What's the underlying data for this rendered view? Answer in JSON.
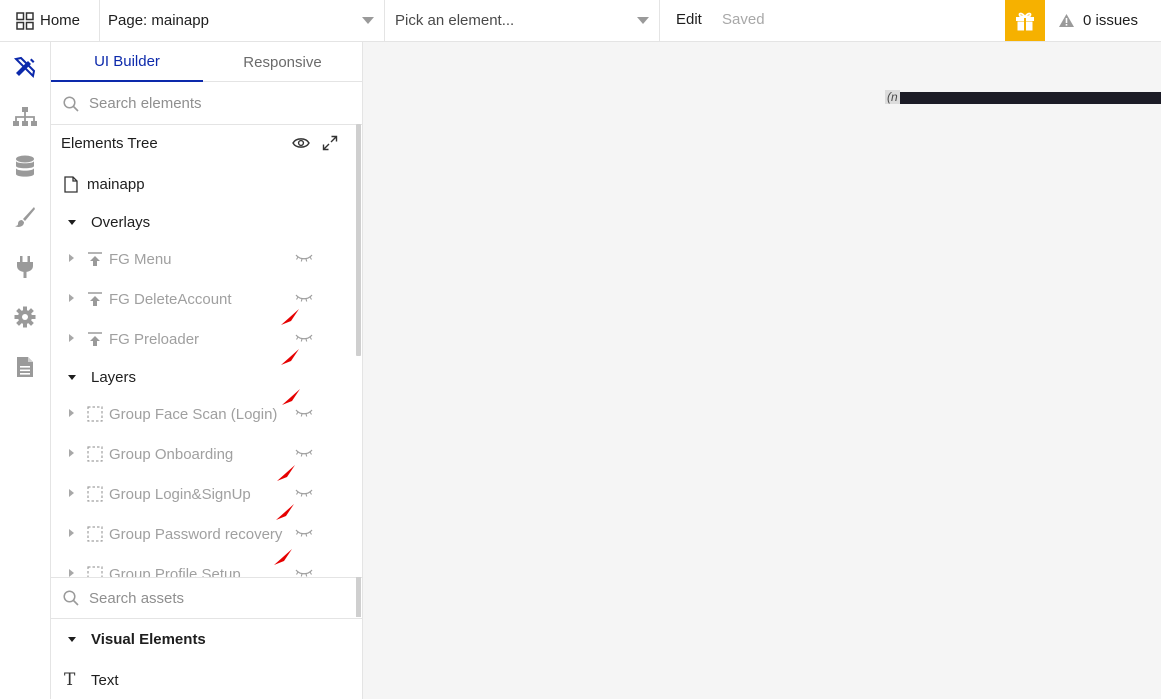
{
  "topbar": {
    "home_label": "Home",
    "page_selector": "Page: mainapp",
    "element_picker_placeholder": "Pick an element...",
    "edit_label": "Edit",
    "save_status": "Saved",
    "issues_label": "0 issues",
    "gift_color": "#f6b100"
  },
  "rail": {
    "items": [
      {
        "icon": "design-icon",
        "active": true
      },
      {
        "icon": "sitemap-icon"
      },
      {
        "icon": "database-icon"
      },
      {
        "icon": "brush-icon"
      },
      {
        "icon": "plug-icon"
      },
      {
        "icon": "gear-icon"
      },
      {
        "icon": "document-icon"
      }
    ],
    "accent": "#0c29ab"
  },
  "panel": {
    "tabs": [
      {
        "label": "UI Builder",
        "active": true
      },
      {
        "label": "Responsive",
        "active": false
      }
    ],
    "search_placeholder": "Search elements",
    "tree_title": "Elements Tree",
    "page_item": "mainapp",
    "overlays_label": "Overlays",
    "overlays": [
      "FG Menu",
      "FG DeleteAccount",
      "FG Preloader"
    ],
    "layers_label": "Layers",
    "layers": [
      "Group Face Scan (Login)",
      "Group Onboarding",
      "Group Login&SignUp",
      "Group Password recovery",
      "Group Profile Setup"
    ],
    "assets_search_placeholder": "Search assets",
    "visual_elements_label": "Visual Elements",
    "visual_items": [
      {
        "label": "Text",
        "icon": "text-icon"
      }
    ]
  },
  "canvas": {
    "selected_label": "(n"
  }
}
